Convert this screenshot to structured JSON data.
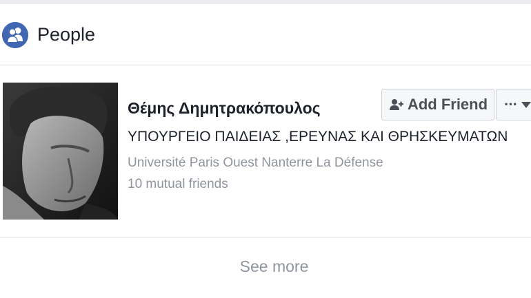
{
  "header": {
    "title": "People",
    "icon": "people-icon"
  },
  "result": {
    "name": "Θέμης Δημητρακόπουλος",
    "workplace": "ΥΠΟΥΡΓΕΙΟ ΠΑΙΔΕΙΑΣ ,ΕΡΕΥΝΑΣ ΚΑΙ ΘΡΗΣΚΕΥΜΑΤΩΝ",
    "school": "Université Paris Ouest Nanterre La Défense",
    "mutual_friends": "10 mutual friends",
    "add_friend_label": "Add Friend",
    "more_label": "···"
  },
  "footer": {
    "see_more_label": "See more"
  },
  "colors": {
    "accent": "#4267b2",
    "text_primary": "#1d2129",
    "text_secondary": "#90949c",
    "button_bg": "#f6f7f9",
    "border": "#dddfe2"
  }
}
